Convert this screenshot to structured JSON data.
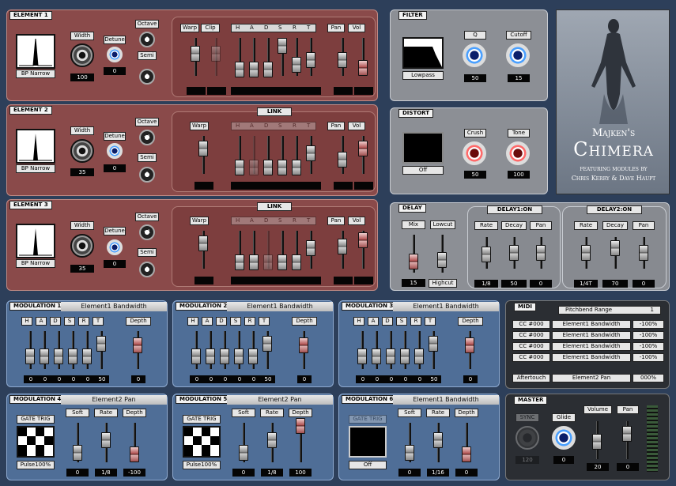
{
  "element1": {
    "tag": "ELEMENT 1",
    "shape": "BP Narrow",
    "width_label": "Width",
    "width_value": "100",
    "detune_label": "Detune",
    "detune_value": "0",
    "octave_label": "Octave",
    "octave_value": "0",
    "semi_label": "Semi",
    "semi_value": "0",
    "warp": "Warp",
    "clip": "Clip",
    "h": "H",
    "a": "A",
    "d": "D",
    "s": "S",
    "r": "R",
    "t": "T",
    "pan": "Pan",
    "vol": "Vol",
    "vals": [
      "100",
      "100",
      "0",
      "0",
      "0",
      "100",
      "25",
      "50",
      "0",
      "7"
    ]
  },
  "element2": {
    "tag": "ELEMENT 2",
    "link": "LINK",
    "shape": "BP Narrow",
    "width_label": "Width",
    "width_value": "35",
    "detune_label": "Detune",
    "detune_value": "0",
    "octave_label": "Octave",
    "octave_value": "+1",
    "semi_label": "Semi",
    "semi_value": "0",
    "warp": "Warp",
    "pan": "Pan",
    "vol": "Vol",
    "vals": [
      "100",
      "0",
      "0",
      "0",
      "0",
      "0",
      "50",
      "-50",
      "100"
    ]
  },
  "element3": {
    "tag": "ELEMENT 3",
    "link": "LINK",
    "shape": "BP Narrow",
    "width_label": "Width",
    "width_value": "35",
    "detune_label": "Detune",
    "detune_value": "0",
    "octave_label": "Octave",
    "octave_value": "+1",
    "semi_label": "Semi",
    "semi_value": "0",
    "warp": "Warp",
    "pan": "Pan",
    "vol": "Vol",
    "vals": [
      "100",
      "0",
      "0",
      "0",
      "0",
      "0",
      "50",
      "50",
      "100"
    ]
  },
  "filter": {
    "tag": "FILTER",
    "type": "Lowpass",
    "q_label": "Q",
    "q_value": "50",
    "cutoff_label": "Cutoff",
    "cutoff_value": "15"
  },
  "distort": {
    "tag": "DISTORT",
    "type": "Off",
    "crush_label": "Crush",
    "crush_value": "50",
    "tone_label": "Tone",
    "tone_value": "100"
  },
  "logo": {
    "line1": "Majken's",
    "line2": "Chimera",
    "line3": "featuring modules by",
    "line4": "Chris Kerry & Dave Haupt"
  },
  "delay": {
    "tag": "DELAY",
    "mix": "Mix",
    "lowcut": "Lowcut",
    "mix_value": "15",
    "highcut": "Highcut",
    "d1_tag": "DELAY1:ON",
    "d2_tag": "DELAY2:ON",
    "rate": "Rate",
    "decay": "Decay",
    "pan": "Pan",
    "d1_rate": "1/8",
    "d1_decay": "50",
    "d1_pan": "0",
    "d2_rate": "1/4T",
    "d2_decay": "70",
    "d2_pan": "0"
  },
  "mod1": {
    "tag": "MODULATION 1",
    "target": "Element1 Bandwidth",
    "depth": "Depth",
    "vals": [
      "0",
      "0",
      "0",
      "0",
      "0",
      "50",
      "0"
    ]
  },
  "mod2": {
    "tag": "MODULATION 2",
    "target": "Element1 Bandwidth",
    "depth": "Depth",
    "vals": [
      "0",
      "0",
      "0",
      "0",
      "0",
      "50",
      "0"
    ]
  },
  "mod3": {
    "tag": "MODULATION 3",
    "target": "Element1 Bandwidth",
    "depth": "Depth",
    "vals": [
      "0",
      "0",
      "0",
      "0",
      "0",
      "50",
      "0"
    ]
  },
  "adsr": [
    "H",
    "A",
    "D",
    "S",
    "R",
    "T"
  ],
  "midi": {
    "tag": "MIDI",
    "pb_label": "Pitchbend Range",
    "pb_value": "1",
    "rows": [
      [
        "CC #000",
        "Element1 Bandwidth",
        "-100%"
      ],
      [
        "CC #000",
        "Element1 Bandwidth",
        "-100%"
      ],
      [
        "CC #000",
        "Element1 Bandwidth",
        "-100%"
      ],
      [
        "CC #000",
        "Element1 Bandwidth",
        "-100%"
      ]
    ],
    "at_label": "Aftertouch",
    "at_target": "Element2 Pan",
    "at_value": "000%"
  },
  "mod4": {
    "tag": "MODULATION 4",
    "target": "Element2 Pan",
    "gate": "GATE TRIG",
    "shape": "Pulse100%",
    "soft": "Soft",
    "rate": "Rate",
    "depth": "Depth",
    "soft_v": "0",
    "rate_v": "1/8",
    "depth_v": "-100"
  },
  "mod5": {
    "tag": "MODULATION 5",
    "target": "Element2 Pan",
    "gate": "GATE TRIG",
    "shape": "Pulse100%",
    "soft": "Soft",
    "rate": "Rate",
    "depth": "Depth",
    "soft_v": "0",
    "rate_v": "1/8",
    "depth_v": "100"
  },
  "mod6": {
    "tag": "MODULATION 6",
    "target": "Element1 Bandwidth",
    "gate": "GATE TRIG",
    "shape": "Off",
    "soft": "Soft",
    "rate": "Rate",
    "depth": "Depth",
    "soft_v": "0",
    "rate_v": "1/16",
    "depth_v": "0"
  },
  "master": {
    "tag": "MASTER",
    "sync": "SYNC",
    "sync_v": "120",
    "glide": "Glide",
    "glide_v": "0",
    "volume": "Volume",
    "pan": "Pan",
    "volume_v": "20",
    "pan_v": "0"
  }
}
